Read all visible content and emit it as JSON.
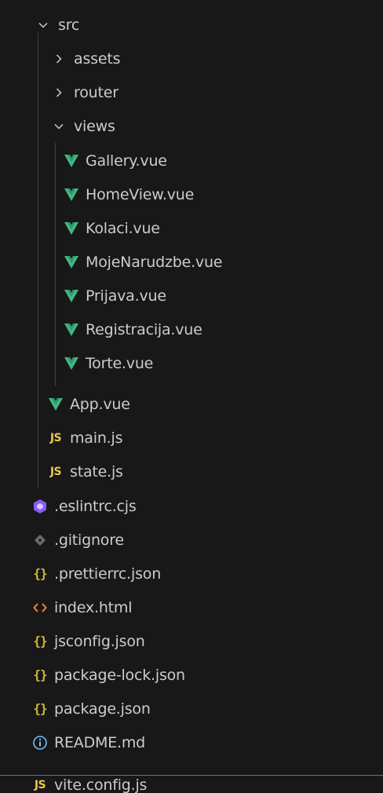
{
  "explorer": {
    "folders": {
      "src": "src",
      "assets": "assets",
      "router": "router",
      "views": "views"
    },
    "views_files": [
      "Gallery.vue",
      "HomeView.vue",
      "Kolaci.vue",
      "MojeNarudzbe.vue",
      "Prijava.vue",
      "Registracija.vue",
      "Torte.vue"
    ],
    "src_files": {
      "app": "App.vue",
      "main": "main.js",
      "state": "state.js"
    },
    "root_files": [
      ".eslintrc.cjs",
      ".gitignore",
      ".prettierrc.json",
      "index.html",
      "jsconfig.json",
      "package-lock.json",
      "package.json",
      "README.md",
      "vite.config.js"
    ],
    "icon_text": {
      "js": "JS",
      "json": "{}"
    },
    "colors": {
      "background": "#181818",
      "text": "#cccccc",
      "vue_green": "#41b883",
      "js_yellow": "#e8c84d",
      "json_yellow": "#d4b83a",
      "eslint_purple": "#8b5cf6",
      "git_grey": "#6b6b6b",
      "html_orange": "#e37933",
      "info_blue": "#75beff",
      "focus_blue": "#2b79d6"
    }
  }
}
